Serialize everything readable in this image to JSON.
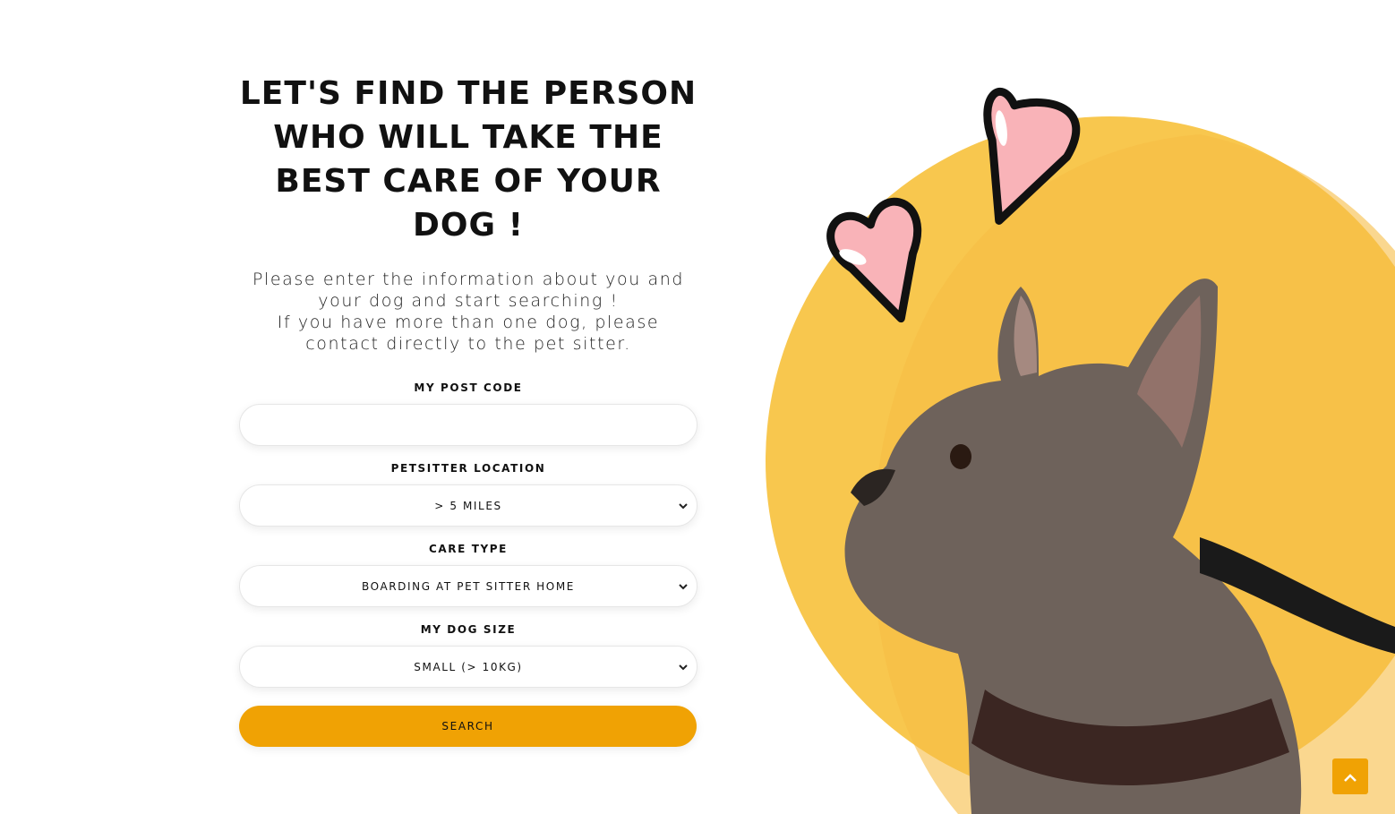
{
  "hero": {
    "title": "Let's find the person who will take the best care of your dog !",
    "intro_line1": "Please enter the information about you and your dog and start searching !",
    "intro_line2": "If you have more than one dog, please contact directly to the pet sitter."
  },
  "form": {
    "postcode": {
      "label": "My post code",
      "value": "",
      "placeholder": ""
    },
    "location": {
      "label": "Petsitter location",
      "selected": "> 5 miles"
    },
    "care_type": {
      "label": "Care type",
      "selected": "Boarding at pet sitter home"
    },
    "dog_size": {
      "label": "My dog size",
      "selected": "Small (> 10kg)"
    },
    "search_label": "Search"
  },
  "icons": {
    "select_chevron": "chevron-down-icon",
    "scroll_top": "chevron-up-icon"
  },
  "colors": {
    "accent": "#f0a204",
    "circle": "#f8c04a",
    "heart": "#f9b3b8"
  }
}
